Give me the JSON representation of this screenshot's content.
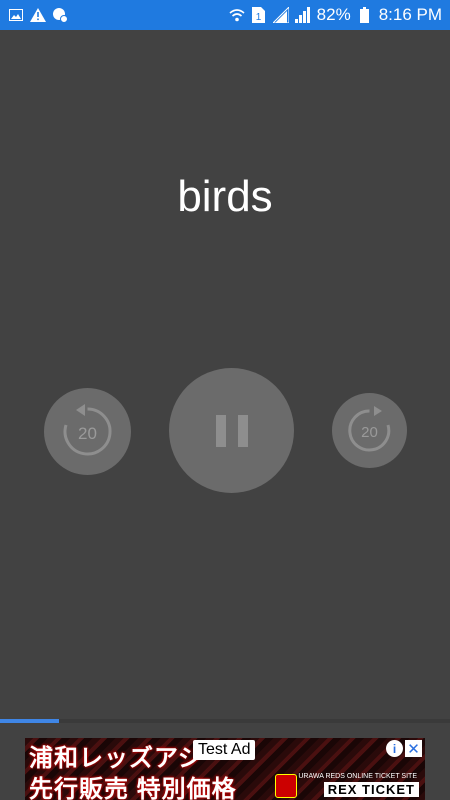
{
  "status_bar": {
    "battery_percent": "82%",
    "time": "8:16 PM",
    "left_icons": [
      "image-icon",
      "warning-icon",
      "settings-notification-icon"
    ],
    "right_icons": [
      "wifi-icon",
      "sim-icon",
      "signal-icon",
      "signal-icon",
      "battery-icon"
    ]
  },
  "player": {
    "title": "birds",
    "rewind_label": "20",
    "forward_label": "20",
    "state": "playing",
    "progress": 0.13
  },
  "ad": {
    "label": "Test Ad",
    "line1": "浦和レッズアジ",
    "line2": "先行販売 特別価格",
    "small_text": "URAWA REDS ONLINE TICKET SITE",
    "ticket": "REX TICKET",
    "info_symbol": "i",
    "close_symbol": "✕"
  }
}
